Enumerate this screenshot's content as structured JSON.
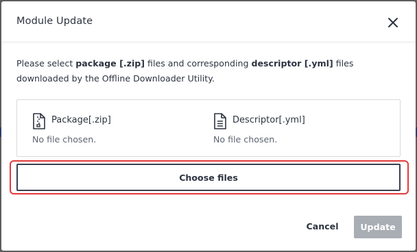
{
  "dialog": {
    "title": "Module Update",
    "description": {
      "part1": "Please select ",
      "bold1": "package [.zip]",
      "part2": " files and corresponding ",
      "bold2": "descriptor [.yml]",
      "part3": " files downloaded by the Offline Downloader Utility."
    },
    "files": [
      {
        "label": "Package[.zip]",
        "status": "No file chosen.",
        "icon": "zip-file-icon"
      },
      {
        "label": "Descriptor[.yml]",
        "status": "No file chosen.",
        "icon": "document-file-icon"
      }
    ],
    "choose_label": "Choose files",
    "cancel_label": "Cancel",
    "update_label": "Update",
    "close_icon": "close-icon"
  },
  "colors": {
    "text": "#2d3340",
    "muted": "#5d6470",
    "highlight": "#e23a3a",
    "disabled_button": "#a9adb4",
    "backdrop": "#5e5e5e"
  }
}
